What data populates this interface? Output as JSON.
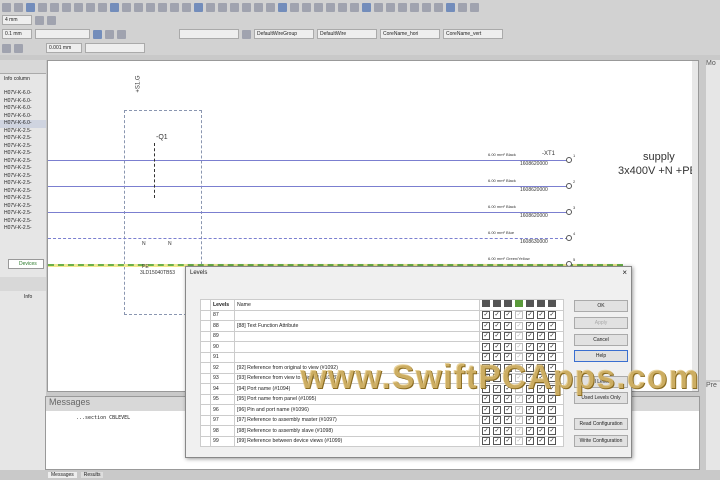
{
  "toolbar": {
    "text_height": "4 mm",
    "line_width": "0.1 mm",
    "grid": "0.001 mm",
    "wire_group": "DefaultWireGroup",
    "wire": "DefaultWire",
    "core_hori": "CoreName_hori",
    "core_vert": "CoreName_vert"
  },
  "left_panel": {
    "header": "Info column",
    "items": [
      "H07V-K-6.0-",
      "H07V-K-6.0-",
      "H07V-K-6.0-",
      "H07V-K-6.0-",
      "H07V-K-6.0-",
      "H07V-K-2.5-",
      "H07V-K-2.5-",
      "H07V-K-2.5-",
      "H07V-K-2.5-",
      "H07V-K-2.5-",
      "H07V-K-2.5-",
      "H07V-K-2.5-",
      "H07V-K-2.5-",
      "H07V-K-2.5-",
      "H07V-K-2.5-",
      "H07V-K-2.5-",
      "H07V-K-2.5-",
      "H07V-K-2.5-",
      "H07V-K-2.5-"
    ],
    "tab": "Devices",
    "info_header": "Info"
  },
  "schematic": {
    "location": "+S1.G",
    "device": "-Q1",
    "pins": [
      "1",
      "2",
      "3",
      "4",
      "5",
      "6"
    ],
    "n_label": "N",
    "pe_label": "PE",
    "part": "3LD15040TB53",
    "terminal": "-XT1",
    "wires": [
      {
        "spec": "6.00 mm²",
        "color": "Black",
        "part": "1608620000",
        "no": "1"
      },
      {
        "spec": "6.00 mm²",
        "color": "Black",
        "part": "1608620000",
        "no": "2"
      },
      {
        "spec": "6.00 mm²",
        "color": "Black",
        "part": "1608620000",
        "no": "3"
      },
      {
        "spec": "6.00 mm²",
        "color": "Blue",
        "part": "1608630000",
        "no": "4"
      },
      {
        "spec": "6.00 mm²",
        "color": "Green/Yellow",
        "part": "",
        "no": "5"
      }
    ],
    "supply_line1": "supply",
    "supply_line2": "3x400V +N +PE"
  },
  "messages": {
    "title": "Messages",
    "text": "...section CBLEVEL",
    "tabs": [
      "Messages",
      "Results"
    ]
  },
  "right_panel": {
    "top": "Mo",
    "bottom": "Pre"
  },
  "dialog": {
    "title": "Levels",
    "col_levels": "Levels",
    "col_name": "Name",
    "rows": [
      {
        "level": "87",
        "name": ""
      },
      {
        "level": "88",
        "name": "[88] Text Function Attribute"
      },
      {
        "level": "89",
        "name": ""
      },
      {
        "level": "90",
        "name": ""
      },
      {
        "level": "91",
        "name": ""
      },
      {
        "level": "92",
        "name": "[92] Reference from original to view (#1092)"
      },
      {
        "level": "93",
        "name": "[93] Reference from view to original (#1093)"
      },
      {
        "level": "94",
        "name": "[94] Port name (#1094)"
      },
      {
        "level": "95",
        "name": "[95] Port name from panel (#1095)"
      },
      {
        "level": "96",
        "name": "[96] Pin and port name (#1096)"
      },
      {
        "level": "97",
        "name": "[97] Reference to assembly master (#1097)"
      },
      {
        "level": "98",
        "name": "[98] Reference to assembly slave (#1098)"
      },
      {
        "level": "99",
        "name": "[99] Reference between device views (#1099)"
      }
    ],
    "buttons": {
      "ok": "OK",
      "apply": "Apply",
      "cancel": "Cancel",
      "help": "Help",
      "all": "All Levels",
      "used": "Used Levels Only",
      "read": "Read Configuration",
      "write": "Write Configuration"
    }
  },
  "watermark": "www.SwiftPCApps.com"
}
